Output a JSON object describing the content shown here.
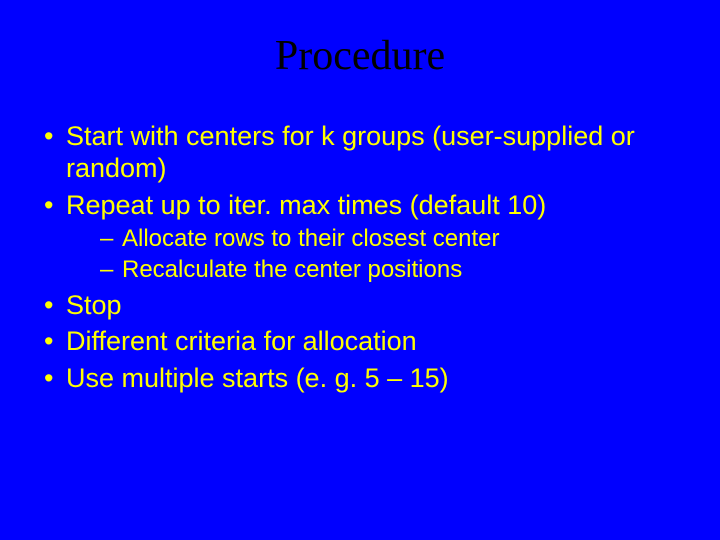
{
  "title": "Procedure",
  "bullets": {
    "b0": "Start with centers for k groups (user-supplied or random)",
    "b1": "Repeat up to iter. max times (default 10)",
    "b1_sub0": "Allocate rows to their closest center",
    "b1_sub1": "Recalculate the center positions",
    "b2": "Stop",
    "b3": "Different criteria for allocation",
    "b4": "Use multiple starts (e. g. 5 – 15)"
  }
}
